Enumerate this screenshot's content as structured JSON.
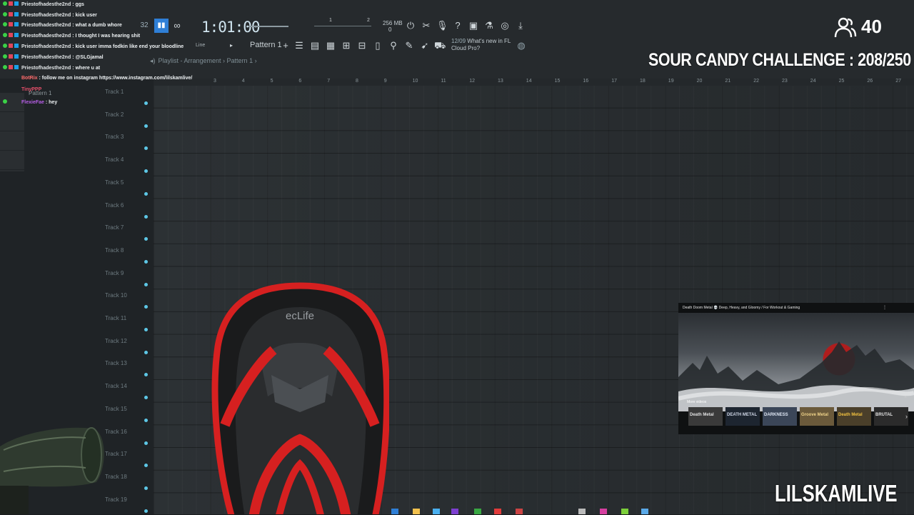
{
  "toolbar": {
    "time": "1:01:00",
    "memory": "256 MB",
    "memory_sub": "0",
    "pattern": "Pattern 1",
    "snap": "Line",
    "hint_date": "12/09",
    "hint_text": "What's new in FL",
    "hint_text2": "Cloud Pro?",
    "pos_num_1": "1",
    "pos_num_2": "2",
    "tempo": "32"
  },
  "breadcrumb": "Playlist - Arrangement › Pattern 1 ›",
  "pattern_picker_label": "Pattern 1",
  "ruler": [
    "3",
    "4",
    "5",
    "6",
    "7",
    "8",
    "9",
    "10",
    "11",
    "12",
    "13",
    "14",
    "15",
    "16",
    "17",
    "18",
    "19",
    "20",
    "21",
    "22",
    "23",
    "24",
    "25",
    "26",
    "27"
  ],
  "tracks": [
    "Track 1",
    "Track 2",
    "Track 3",
    "Track 4",
    "Track 5",
    "Track 6",
    "Track 7",
    "Track 8",
    "Track 9",
    "Track 10",
    "Track 11",
    "Track 12",
    "Track 13",
    "Track 14",
    "Track 15",
    "Track 16",
    "Track 17",
    "Track 18",
    "Track 19"
  ],
  "chat": [
    {
      "user": "Priestofhadesthe2nd",
      "msg": "ggs",
      "color": "#e0e4e6"
    },
    {
      "user": "Priestofhadesthe2nd",
      "msg": "kick user",
      "color": "#e0e4e6"
    },
    {
      "user": "Priestofhadesthe2nd",
      "msg": "what a dumb whore",
      "color": "#e0e4e6"
    },
    {
      "user": "Priestofhadesthe2nd",
      "msg": "I thought I was hearing shit",
      "color": "#e0e4e6"
    },
    {
      "user": "Priestofhadesthe2nd",
      "msg": "kick user imma fodkin like end your bloodline",
      "color": "#e0e4e6"
    },
    {
      "user": "Priestofhadesthe2nd",
      "msg": "@SLGjamal",
      "color": "#e0e4e6"
    },
    {
      "user": "Priestofhadesthe2nd",
      "msg": "where u at",
      "color": "#e0e4e6"
    },
    {
      "user": "BotRix",
      "msg": "follow me on instagram https://www.instagram.com/lilskamlive/",
      "color": "#ff6b6b"
    },
    {
      "user": "TinyPPP",
      "msg": "",
      "color": "#e64f6a"
    },
    {
      "user": "FlexieFae",
      "msg": "hey",
      "color": "#b65fe6"
    }
  ],
  "viewer_count": "40",
  "challenge": "SOUR CANDY CHALLENGE : 208/250",
  "channel_name": "LILSKAMLIVE",
  "video": {
    "title": "Death Doom Metal 💀 Deep, Heavy, and Gloomy / For Workout & Gaming",
    "more_label": "More videos",
    "thumbs": [
      "Death Metal",
      "DEATH METAL",
      "DARKNESS",
      "Groove Metal",
      "Death Metal",
      "BRUTAL"
    ]
  },
  "chair_logo": "ecLife"
}
